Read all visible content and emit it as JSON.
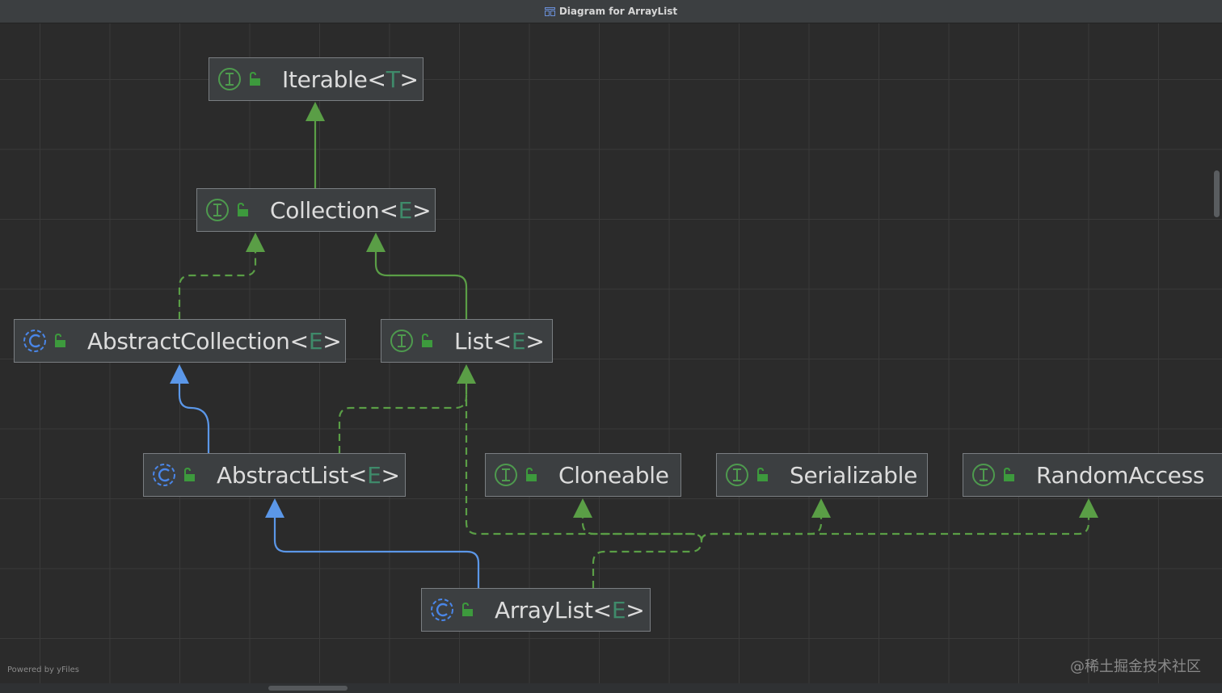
{
  "window": {
    "title": "Diagram for ArrayList"
  },
  "nodes": [
    {
      "id": "iterable",
      "kind": "interface",
      "name": "Iterable",
      "type_param": "T"
    },
    {
      "id": "collection",
      "kind": "interface",
      "name": "Collection",
      "type_param": "E"
    },
    {
      "id": "abstract-collection",
      "kind": "class",
      "name": "AbstractCollection",
      "type_param": "E"
    },
    {
      "id": "list",
      "kind": "interface",
      "name": "List",
      "type_param": "E"
    },
    {
      "id": "abstract-list",
      "kind": "class",
      "name": "AbstractList",
      "type_param": "E"
    },
    {
      "id": "cloneable",
      "kind": "interface",
      "name": "Cloneable",
      "type_param": ""
    },
    {
      "id": "serializable",
      "kind": "interface",
      "name": "Serializable",
      "type_param": ""
    },
    {
      "id": "random-access",
      "kind": "interface",
      "name": "RandomAccess",
      "type_param": ""
    },
    {
      "id": "array-list",
      "kind": "class",
      "name": "ArrayList",
      "type_param": "E"
    }
  ],
  "edges": [
    {
      "from": "collection",
      "to": "iterable",
      "relation": "extends"
    },
    {
      "from": "abstract-collection",
      "to": "collection",
      "relation": "implements"
    },
    {
      "from": "list",
      "to": "collection",
      "relation": "extends"
    },
    {
      "from": "abstract-list",
      "to": "abstract-collection",
      "relation": "extends"
    },
    {
      "from": "abstract-list",
      "to": "list",
      "relation": "implements"
    },
    {
      "from": "array-list",
      "to": "abstract-list",
      "relation": "extends"
    },
    {
      "from": "array-list",
      "to": "list",
      "relation": "implements"
    },
    {
      "from": "array-list",
      "to": "cloneable",
      "relation": "implements"
    },
    {
      "from": "array-list",
      "to": "serializable",
      "relation": "implements"
    },
    {
      "from": "array-list",
      "to": "random-access",
      "relation": "implements"
    }
  ],
  "colors": {
    "interface_icon": "#4e9a4e",
    "class_icon": "#4a86e8",
    "lock_icon": "#3d9a3d",
    "extends_interface_edge": "#5a9e46",
    "extends_class_edge": "#5b97e8",
    "implements_edge": "#5a9e46",
    "type_param": "#3f8a6a"
  },
  "footer": {
    "powered_by": "Powered by yFiles",
    "watermark": "@稀土掘金技术社区"
  }
}
